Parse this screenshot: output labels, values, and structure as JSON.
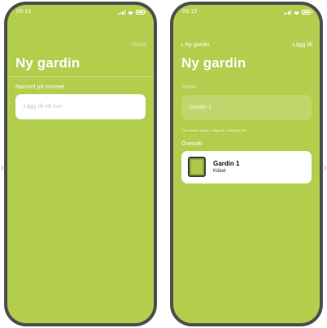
{
  "colors": {
    "screen_green": "#b3cd4d",
    "phone_frame": "#4d4d4d",
    "card": "#ffffff",
    "icon_green": "#8da838"
  },
  "nav_arrows": {
    "left": "›",
    "right": "›"
  },
  "screens": [
    {
      "status_time": "09:15",
      "nav_right": "Nästa",
      "title": "Ny gardin",
      "section_label": "Namnet på rummet",
      "input_placeholder": "Lägg till ett rum"
    },
    {
      "status_time": "09:15",
      "nav_back": "Ny gardin",
      "nav_right": "Lägg till",
      "title": "Ny gardin",
      "name_label": "Namn",
      "name_value": "Gardin 1",
      "hint": "T.ex vänster fönster, sidgardin, vänligt fönster",
      "overview_label": "Översikt",
      "card": {
        "title": "Gardin 1",
        "subtitle": "Köket",
        "icon": "curtain-icon"
      }
    }
  ]
}
